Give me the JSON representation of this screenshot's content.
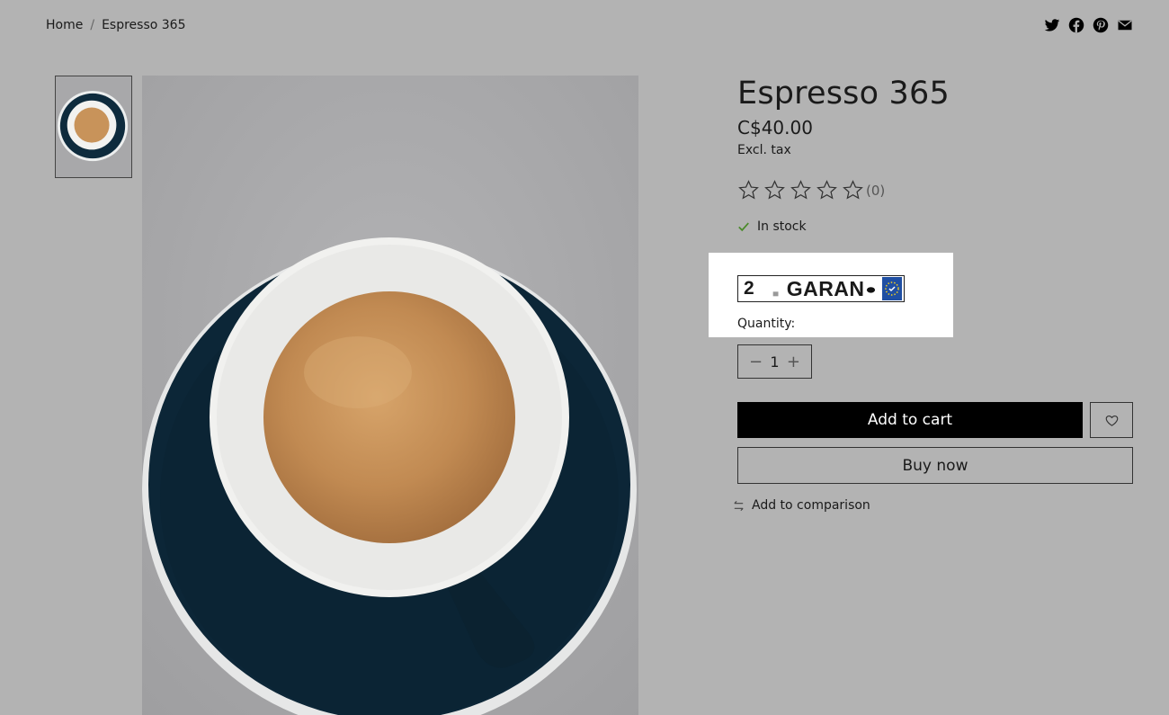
{
  "breadcrumb": {
    "home": "Home",
    "separator": "/",
    "current": "Espresso 365"
  },
  "share": {
    "icons": [
      "twitter-icon",
      "facebook-icon",
      "pinterest-icon",
      "mail-icon"
    ]
  },
  "product": {
    "title": "Espresso 365",
    "price": "C$40.00",
    "tax_note": "Excl. tax",
    "rating": {
      "stars": 0,
      "max": 5,
      "count_label": "(0)"
    },
    "stock": "In stock",
    "badge": {
      "number": "2",
      "word": "GARAN"
    },
    "quantity_label": "Quantity:",
    "quantity_value": "1",
    "add_to_cart": "Add to cart",
    "buy_now": "Buy now",
    "compare": "Add to comparison"
  },
  "colors": {
    "overlay": "#b3b3b3",
    "saucer": "#0d2a3c",
    "crema": "#c8935a",
    "stock_check": "#4a8a2a"
  }
}
